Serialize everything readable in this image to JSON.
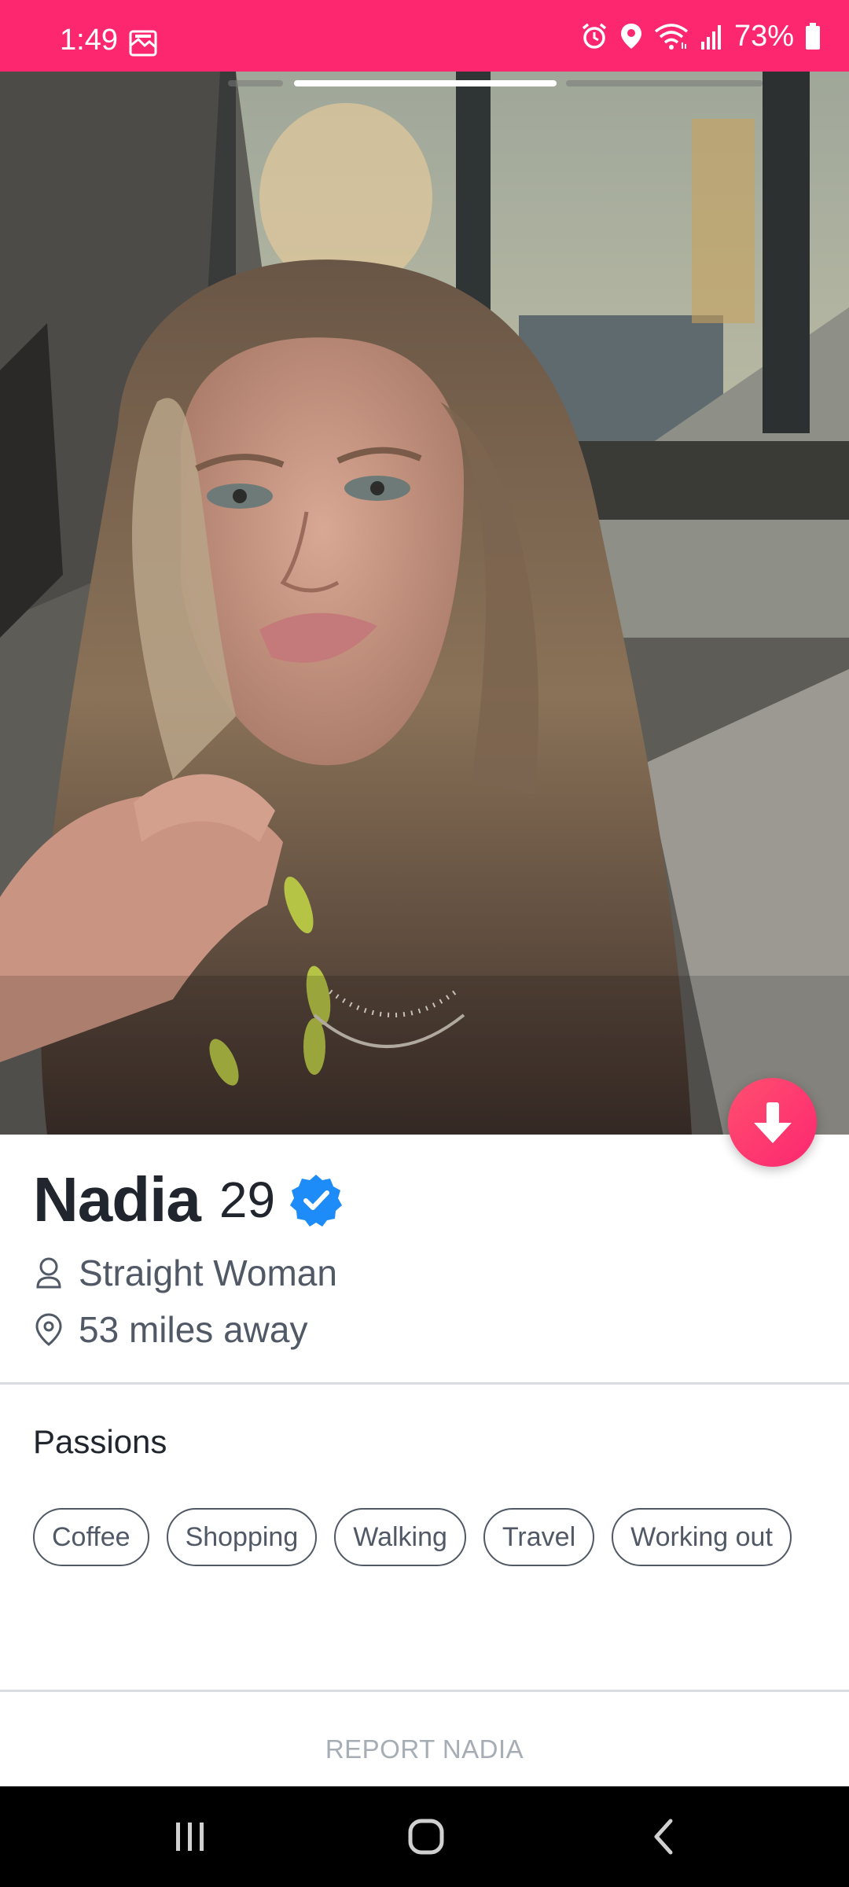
{
  "status_bar": {
    "time": "1:49",
    "battery": "73%",
    "background_color": "#fd2770",
    "icons": [
      "image-icon",
      "alarm-icon",
      "location-icon",
      "wifi-icon",
      "signal-icon",
      "battery-icon"
    ]
  },
  "photo": {
    "current_photo": 2,
    "total_photos": 3
  },
  "profile": {
    "name": "Nadia",
    "age": "29",
    "verified": true,
    "orientation": "Straight Woman",
    "distance": "53 miles away"
  },
  "passions": {
    "title": "Passions",
    "items": [
      "Coffee",
      "Shopping",
      "Walking",
      "Travel",
      "Working out"
    ]
  },
  "report_label": "REPORT NADIA",
  "colors": {
    "accent": "#fd2770",
    "verified_blue": "#1d8cf8",
    "text_dark": "#21262e",
    "text_secondary": "#505965"
  }
}
